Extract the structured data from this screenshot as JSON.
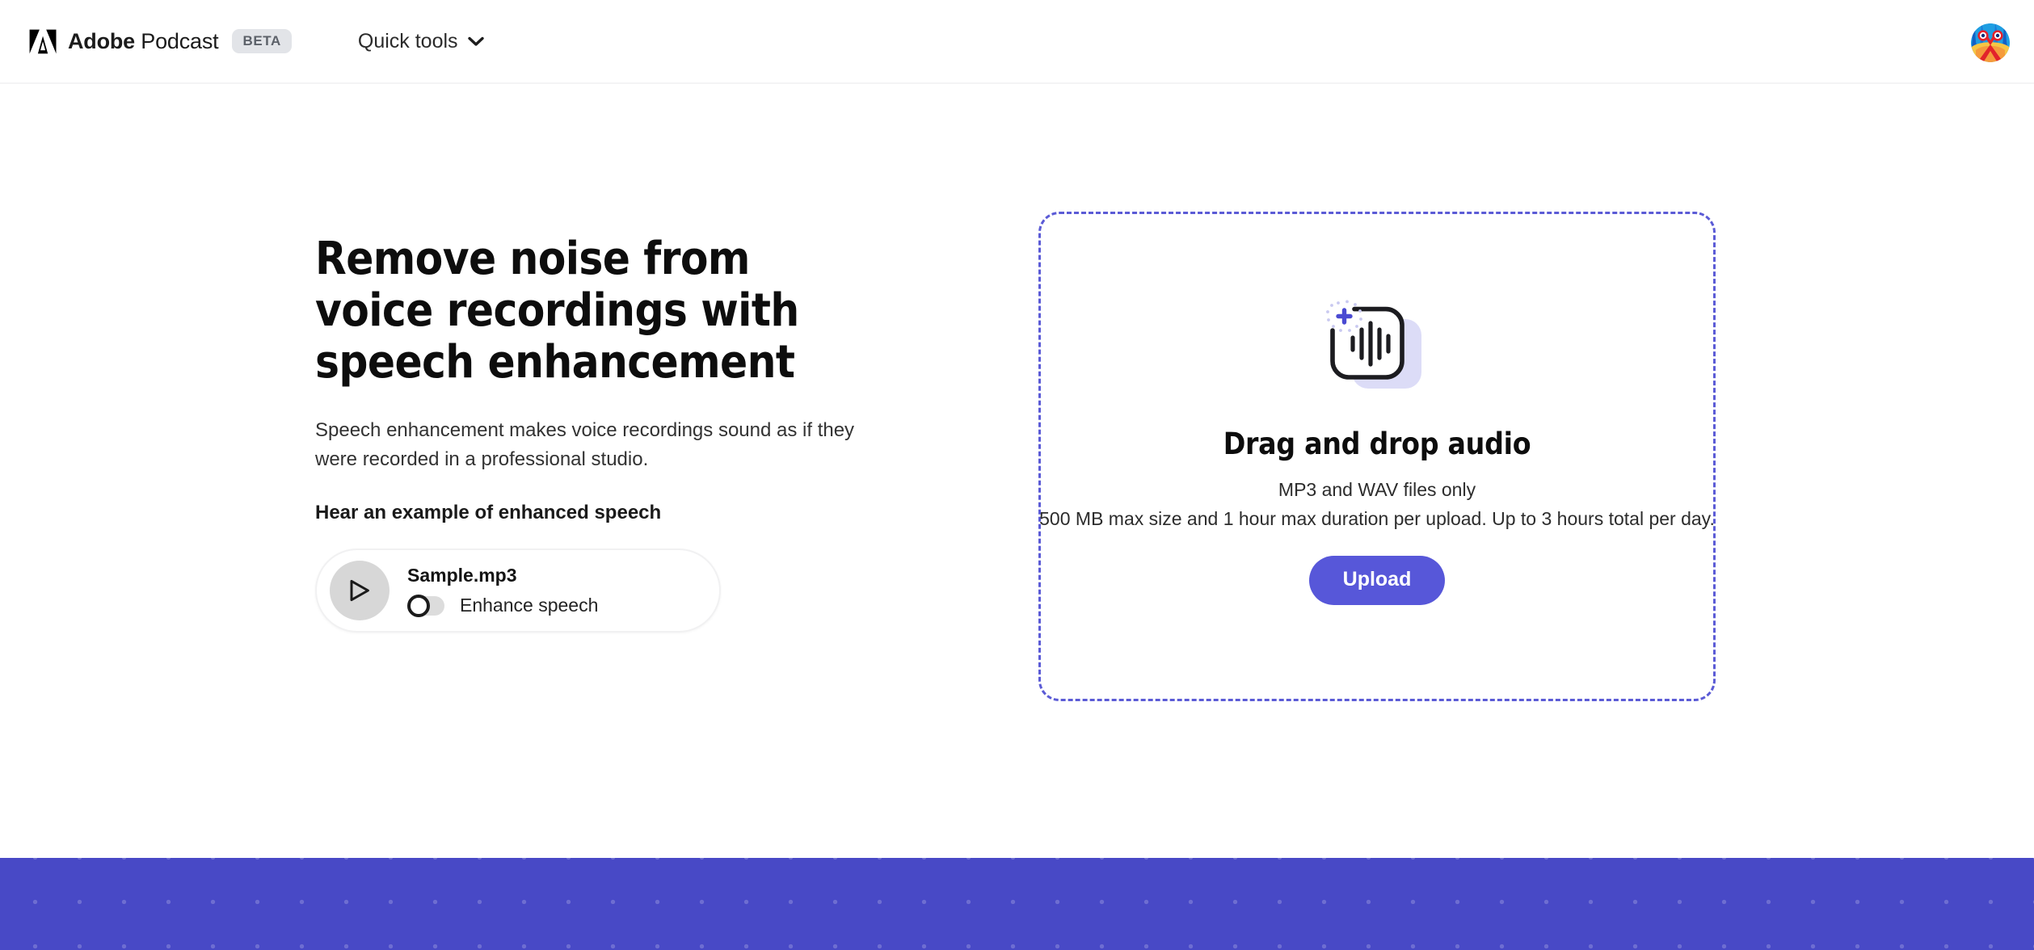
{
  "header": {
    "logo_icon": "adobe-a-logo",
    "brand_bold": "Adobe",
    "brand_light": " Podcast",
    "beta_badge": "BETA",
    "quick_tools_label": "Quick tools",
    "quick_tools_icon": "chevron-down-icon",
    "avatar_icon": "user-avatar-mandrill"
  },
  "hero": {
    "title_line1": "Remove noise from",
    "title_line2": "voice recordings with",
    "title_line3": "speech enhancement",
    "subtitle": "Speech enhancement makes voice recordings sound as if they were recorded in a professional studio.",
    "hear_example_label": "Hear an example of enhanced speech"
  },
  "player": {
    "play_icon": "play-triangle-icon",
    "file_name": "Sample.mp3",
    "toggle_label": "Enhance speech",
    "toggle_state": "off"
  },
  "dropzone": {
    "icon": "audio-file-add-waveform-icon",
    "title": "Drag and drop audio",
    "formats_line": "MP3 and WAV files only",
    "limits_line": "500 MB max size and 1 hour max duration per upload. Up to 3 hours total per day.",
    "upload_label": "Upload"
  },
  "colors": {
    "accent_purple": "#5757d9",
    "dashed_border": "#5b5bd6",
    "footer_band": "#4849c6",
    "icon_shadow_lavender": "#dcdcf7",
    "badge_bg": "#e2e4e8",
    "play_circle": "#d7d7d7"
  },
  "footer": {
    "pattern": "dot-grid"
  }
}
